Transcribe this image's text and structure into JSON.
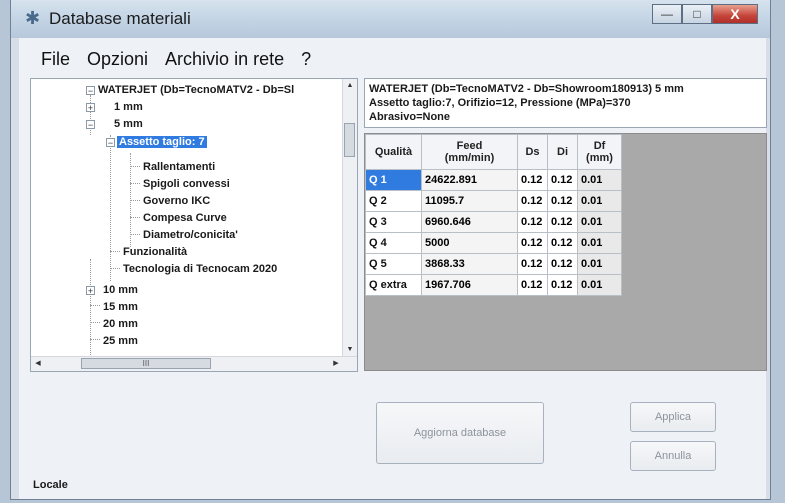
{
  "window": {
    "title": "Database materiali",
    "controls": {
      "minimize": "—",
      "maximize": "□",
      "close": "X"
    }
  },
  "menu": [
    "File",
    "Opzioni",
    "Archivio in rete",
    "?"
  ],
  "tree": {
    "root": "WATERJET (Db=TecnoMATV2 - Db=Sl",
    "thickness_1": "1 mm",
    "thickness_5": "5 mm",
    "selected": "Assetto taglio: 7",
    "children": [
      "Rallentamenti",
      "Spigoli convessi",
      "Governo IKC",
      "Compesa Curve",
      "Diametro/conicita'"
    ],
    "funzionalita": "Funzionalità",
    "tecnologia": "Tecnologia di Tecnocam 2020",
    "others": [
      "10 mm",
      "15 mm",
      "20 mm",
      "25 mm"
    ],
    "hscroll_label": "III"
  },
  "info": {
    "line1": "WATERJET (Db=TecnoMATV2 - Db=Showroom180913) 5 mm",
    "line2": "Assetto taglio:7, Orifizio=12, Pressione (MPa)=370",
    "line3": "Abrasivo=None"
  },
  "grid": {
    "headers": [
      "Qualità",
      "Feed\n(mm/min)",
      "Ds",
      "Di",
      "Df\n(mm)"
    ],
    "header_feed_1": "Feed",
    "header_feed_2": "(mm/min)",
    "header_df_1": "Df",
    "header_df_2": "(mm)",
    "rows": [
      {
        "q": "Q 1",
        "feed": "24622.891",
        "ds": "0.12",
        "di": "0.12",
        "df": "0.01"
      },
      {
        "q": "Q 2",
        "feed": "11095.7",
        "ds": "0.12",
        "di": "0.12",
        "df": "0.01"
      },
      {
        "q": "Q 3",
        "feed": "6960.646",
        "ds": "0.12",
        "di": "0.12",
        "df": "0.01"
      },
      {
        "q": "Q 4",
        "feed": "5000",
        "ds": "0.12",
        "di": "0.12",
        "df": "0.01"
      },
      {
        "q": "Q 5",
        "feed": "3868.33",
        "ds": "0.12",
        "di": "0.12",
        "df": "0.01"
      },
      {
        "q": "Q extra",
        "feed": "1967.706",
        "ds": "0.12",
        "di": "0.12",
        "df": "0.01"
      }
    ]
  },
  "buttons": {
    "aggiorna": "Aggiorna database",
    "applica": "Applica",
    "annulla": "Annulla"
  },
  "status": "Locale",
  "colors": {
    "selection": "#2f7be0",
    "close_button": "#c5443a",
    "grid_background": "#a9a9a9"
  }
}
